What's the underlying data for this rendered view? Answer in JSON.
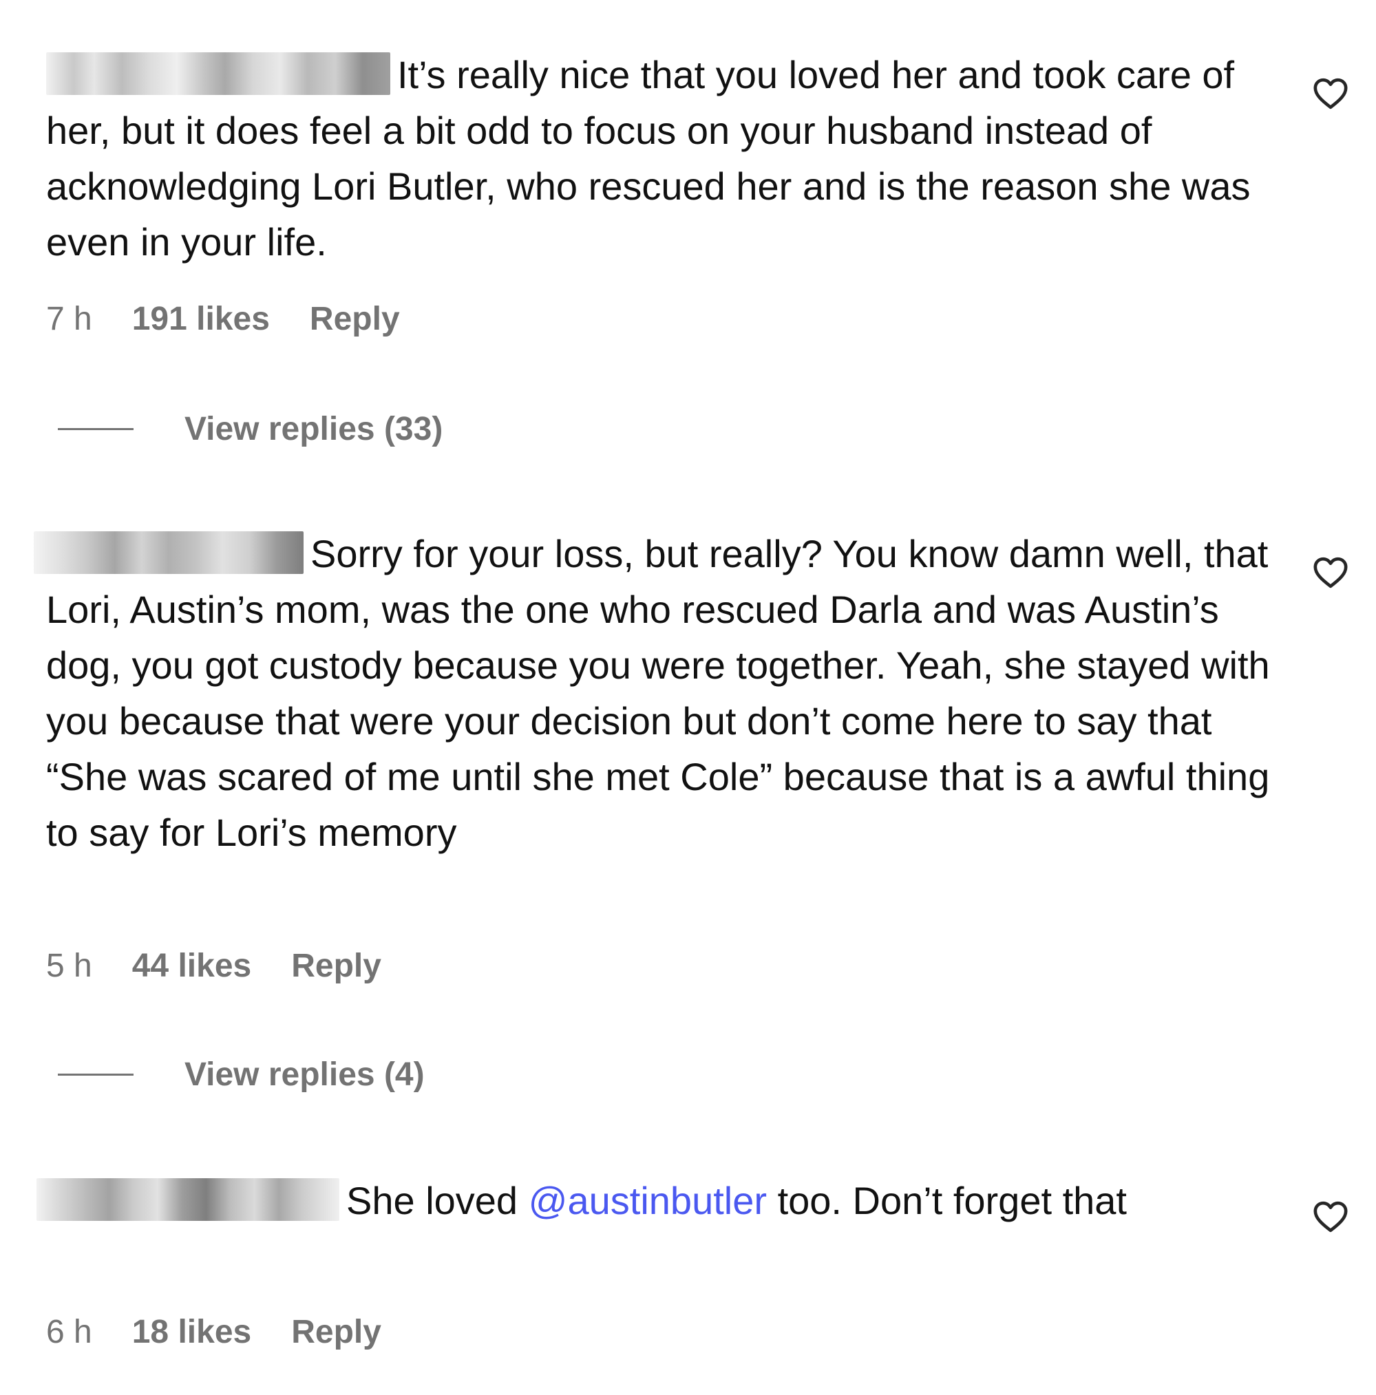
{
  "comments": [
    {
      "text": "It’s really nice that you loved her and took care of her, but it does feel a bit odd to focus on your husband instead of acknowledging Lori Butler, who rescued her and is the reason she was even in your life.",
      "time": "7 h",
      "likes": "191 likes",
      "reply_label": "Reply",
      "view_replies_label": "View replies (33)",
      "like_icon": "heart-outline-icon"
    },
    {
      "text": "Sorry for your loss, but really? You know damn well, that Lori, Austin’s mom, was the one who rescued Darla and was Austin’s dog, you got custody because you were together. Yeah, she stayed with you because that were your decision but don’t come here to say that “She was scared of me until she met Cole” because that is a awful thing to say for Lori’s memory",
      "time": "5 h",
      "likes": "44 likes",
      "reply_label": "Reply",
      "view_replies_label": "View replies (4)",
      "like_icon": "heart-outline-icon"
    },
    {
      "text_before": "She loved ",
      "mention": "@austinbutler",
      "text_after": " too. Don’t forget that",
      "time": "6 h",
      "likes": "18 likes",
      "reply_label": "Reply",
      "like_icon": "heart-outline-icon"
    }
  ],
  "colors": {
    "text": "#111111",
    "meta": "#737373",
    "mention": "#4a58f0"
  }
}
